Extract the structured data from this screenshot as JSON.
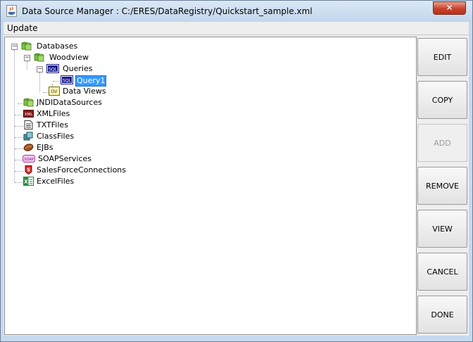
{
  "window": {
    "title": "Data Source Manager : C:/ERES/DataRegistry/Quickstart_sample.xml",
    "close_label": "✕"
  },
  "menu": {
    "items": [
      {
        "label": "Update"
      }
    ]
  },
  "tree": {
    "databases": "Databases",
    "woodview": "Woodview",
    "queries": "Queries",
    "query1": "Query1",
    "dataviews": "Data Views",
    "jndi": "JNDIDataSources",
    "xml": "XMLFiles",
    "txt": "TXTFiles",
    "class": "ClassFiles",
    "ejb": "EJBs",
    "soap": "SOAPServices",
    "salesforce": "SalesForceConnections",
    "excel": "ExcelFiles",
    "selected": "Query1"
  },
  "icons": {
    "sql_text": "SQL",
    "dv_text": "DV",
    "xml_text": "XML",
    "soap_text": "SOAP"
  },
  "buttons": {
    "edit": "EDIT",
    "copy": "COPY",
    "add": "ADD",
    "add_enabled": false,
    "remove": "REMOVE",
    "view": "VIEW",
    "cancel": "CANCEL",
    "done": "DONE"
  },
  "colors": {
    "selection": "#3399ff",
    "close_button": "#c7432b",
    "window_frame": "#c6d9ef"
  }
}
